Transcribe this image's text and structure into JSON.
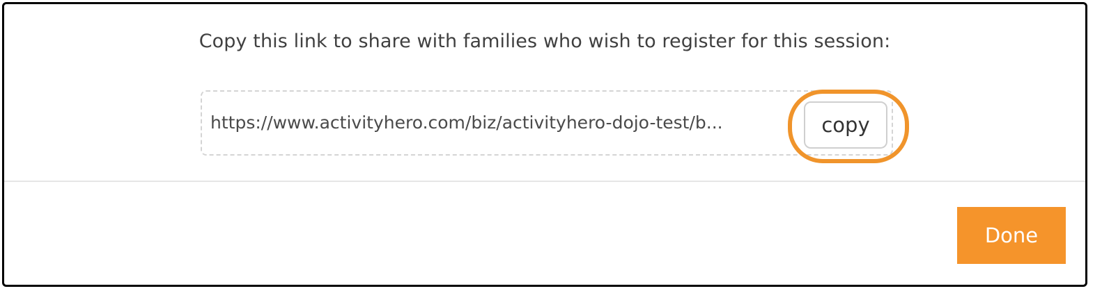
{
  "dialog": {
    "prompt": "Copy this link to share with families who wish to register for this session:",
    "link_url": "https://www.activityhero.com/biz/activityhero-dojo-test/b...",
    "copy_label": "copy",
    "done_label": "Done"
  },
  "colors": {
    "accent": "#f5942b",
    "highlight_ring": "#f0942b",
    "text": "#404040",
    "dashed_border": "#d4d4d4"
  }
}
